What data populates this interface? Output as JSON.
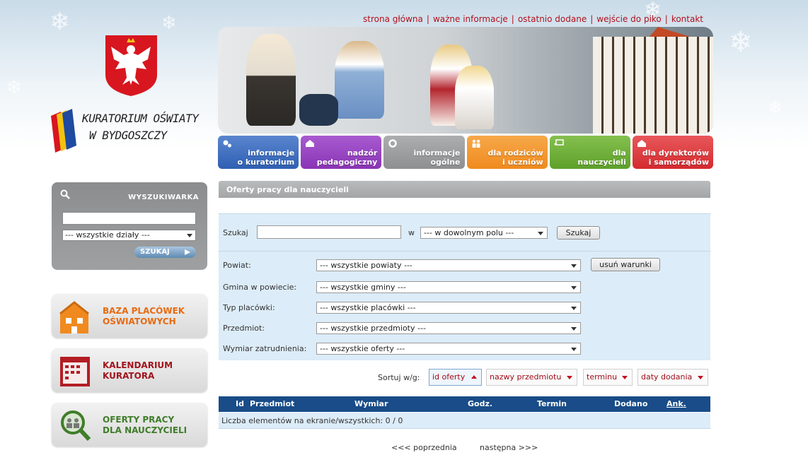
{
  "top_links": [
    "strona główna",
    "ważne informacje",
    "ostatnio dodane",
    "wejście do piko",
    "kontakt"
  ],
  "brand": {
    "line1": "KURATORIUM OŚWIATY",
    "line2": "W BYDGOSZCZY"
  },
  "nav": [
    {
      "line1": "informacje",
      "line2": "o kuratorium",
      "color": "#2f5fb3",
      "icon": "gears-icon"
    },
    {
      "line1": "nadzór",
      "line2": "pedagogiczny",
      "color": "#8a34b5",
      "icon": "house-icon"
    },
    {
      "line1": "informacje",
      "line2": "ogólne",
      "color": "#8e8f90",
      "icon": "gear-icon"
    },
    {
      "line1": "dla rodziców",
      "line2": "i uczniów",
      "color": "#f08a1e",
      "icon": "people-icon"
    },
    {
      "line1": "dla",
      "line2": "nauczycieli",
      "color": "#5ea02a",
      "icon": "board-icon"
    },
    {
      "line1": "dla dyrektorów",
      "line2": "i samorządów",
      "color": "#d42a2f",
      "icon": "house-icon"
    }
  ],
  "sidebar": {
    "search_title": "WYSZUKIWARKA",
    "search_select": "--- wszystkie działy ---",
    "search_button": "SZUKAJ",
    "boxes": [
      {
        "line1": "BAZA PLACÓWEK",
        "line2": "OŚWIATOWYCH",
        "color": "#e86a10",
        "icon": "building-icon"
      },
      {
        "line1": "KALENDARIUM",
        "line2": "KURATORA",
        "color": "#a1141c",
        "icon": "calendar-icon"
      },
      {
        "line1": "OFERTY PRACY",
        "line2": "DLA NAUCZYCIELI",
        "color": "#3f7d2a",
        "icon": "people-search-icon"
      }
    ]
  },
  "content": {
    "title": "Oferty pracy dla nauczycieli",
    "search_label": "Szukaj",
    "in_label": "w",
    "field_select": "--- w dowolnym polu ---",
    "search_button": "Szukaj",
    "clear_button": "usuń warunki",
    "filters": [
      {
        "label": "Powiat:",
        "value": "--- wszystkie powiaty ---"
      },
      {
        "label": "Gmina w powiecie:",
        "value": "--- wszystkie gminy ---"
      },
      {
        "label": "Typ placówki:",
        "value": "--- wszystkie placówki ---"
      },
      {
        "label": "Przedmiot:",
        "value": "--- wszystkie przedmioty ---"
      },
      {
        "label": "Wymiar zatrudnienia:",
        "value": "--- wszystkie oferty ---"
      }
    ],
    "sort_label": "Sortuj w/g:",
    "sort_options": [
      "id oferty",
      "nazwy przedmiotu",
      "terminu",
      "daty dodania"
    ],
    "table_headers": [
      "Id",
      "Przedmiot",
      "Wymiar",
      "Godz.",
      "Termin",
      "Dodano",
      "Ank."
    ],
    "count_text": "Liczba elementów na ekranie/wszystkich: 0 / 0",
    "prev": "<<< poprzednia",
    "next": "następna >>>"
  }
}
